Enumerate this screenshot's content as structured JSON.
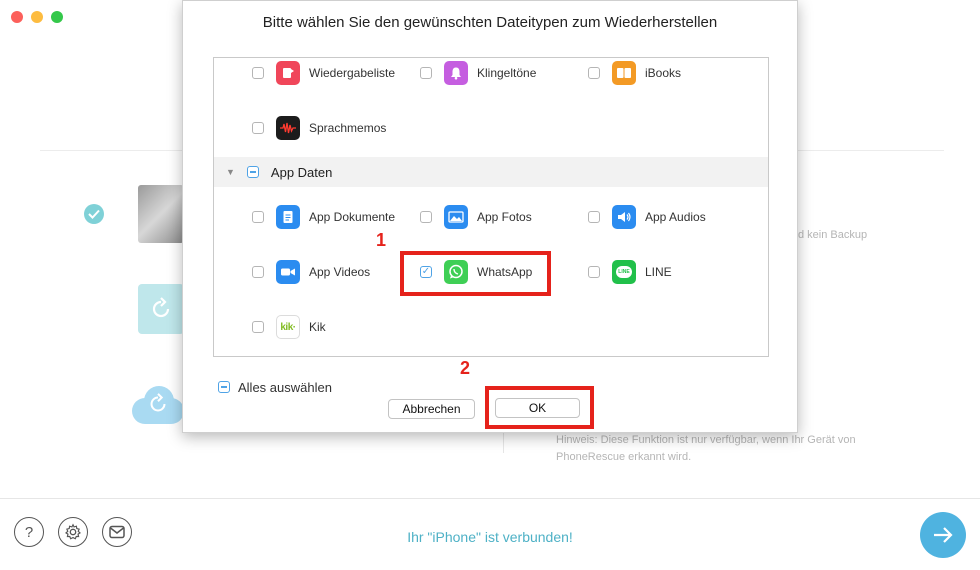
{
  "window": {
    "controls": [
      "close",
      "minimize",
      "zoom"
    ]
  },
  "background": {
    "side_text": "d kein Backup",
    "hint": "Hinweis: Diese Funktion ist nur verfügbar, wenn Ihr Gerät von PhoneRescue erkannt wird."
  },
  "footer": {
    "help_icon_glyph": "?",
    "status": "Ihr \"iPhone\" ist verbunden!"
  },
  "dialog": {
    "title": "Bitte wählen Sie den gewünschten Dateitypen zum Wiederherstellen",
    "rows": [
      {
        "label": "Wiedergabeliste",
        "checked": false,
        "icon": "playlist-icon",
        "color": "#f0465a"
      },
      {
        "label": "Klingeltöne",
        "checked": false,
        "icon": "bell-icon",
        "color": "#c55ee0"
      },
      {
        "label": "iBooks",
        "checked": false,
        "icon": "book-icon",
        "color": "#f39a25"
      },
      {
        "label": "Sprachmemos",
        "checked": false,
        "icon": "voice-memo-icon",
        "color": "#1c1c1c"
      }
    ],
    "section": {
      "label": "App Daten",
      "expanded": true,
      "state": "mixed"
    },
    "app_items": [
      {
        "label": "App Dokumente",
        "checked": false,
        "icon": "document-icon",
        "color": "#2b8cf0"
      },
      {
        "label": "App Fotos",
        "checked": false,
        "icon": "photo-icon",
        "color": "#2b8cf0"
      },
      {
        "label": "App Audios",
        "checked": false,
        "icon": "speaker-icon",
        "color": "#2b8cf0"
      },
      {
        "label": "App Videos",
        "checked": false,
        "icon": "video-icon",
        "color": "#2b8cf0"
      },
      {
        "label": "WhatsApp",
        "checked": true,
        "icon": "whatsapp-icon",
        "color": "#3fcf55"
      },
      {
        "label": "LINE",
        "checked": false,
        "icon": "line-icon",
        "color": "#21c04a"
      },
      {
        "label": "Kik",
        "checked": false,
        "icon": "kik-icon",
        "color": "#82bc23",
        "icon_text": "kik·"
      }
    ],
    "select_all": {
      "label": "Alles auswählen",
      "state": "mixed"
    },
    "cancel_label": "Abbrechen",
    "ok_label": "OK",
    "annotations": [
      "1",
      "2"
    ]
  },
  "colors": {
    "accent": "#4fb3e0",
    "highlight": "#e5221b",
    "status_text": "#4eb1c6"
  }
}
